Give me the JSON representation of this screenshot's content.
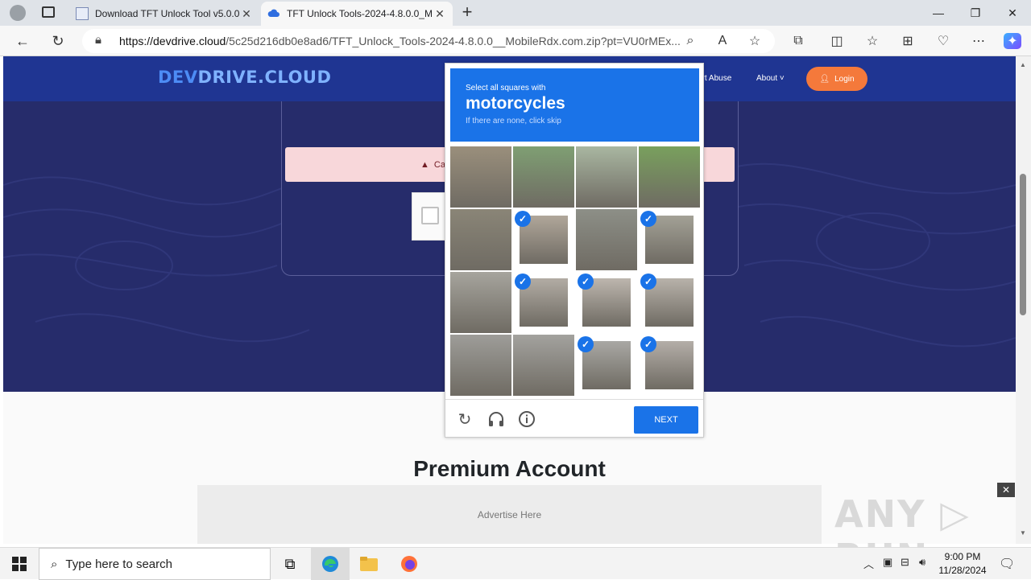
{
  "browser": {
    "tabs": [
      {
        "title": "Download TFT Unlock Tool v5.0.0",
        "active": false
      },
      {
        "title": "TFT Unlock Tools-2024-4.8.0.0_M",
        "active": true
      }
    ],
    "new_tab_label": "+",
    "url_host": "https://devdrive.cloud",
    "url_path": "/5c25d216db0e8ad6/TFT_Unlock_Tools-2024-4.8.0.0__MobileRdx.com.zip?pt=VU0rMEx...",
    "window_controls": {
      "minimize": "—",
      "maximize": "❐",
      "close": "✕"
    }
  },
  "site": {
    "logo_a": "DEV",
    "logo_b": "DRIVE.CLOUD",
    "nav": {
      "report": "ort Abuse",
      "about": "About ˅"
    },
    "login_label": "Login",
    "alert_text": "Ca",
    "premium_heading": "Premium Account",
    "ad_text": "Advertise Here"
  },
  "captcha": {
    "instruction": "Select all squares with",
    "target": "motorcycles",
    "subtext": "If there are none, click skip",
    "next_label": "NEXT",
    "selected_cells": [
      5,
      7,
      9,
      10,
      11,
      14,
      15
    ],
    "footer_icons": [
      "refresh-icon",
      "headphones-icon",
      "info-icon"
    ]
  },
  "watermark": {
    "text": "ANY ▷ RUN",
    "close_label": "✕"
  },
  "taskbar": {
    "search_placeholder": "Type here to search",
    "time": "9:00 PM",
    "date": "11/28/2024"
  },
  "colors": {
    "header_bg": "#1f3592",
    "hero_bg": "#262c6b",
    "captcha_blue": "#1a73e8",
    "login_orange": "#f4793b"
  }
}
